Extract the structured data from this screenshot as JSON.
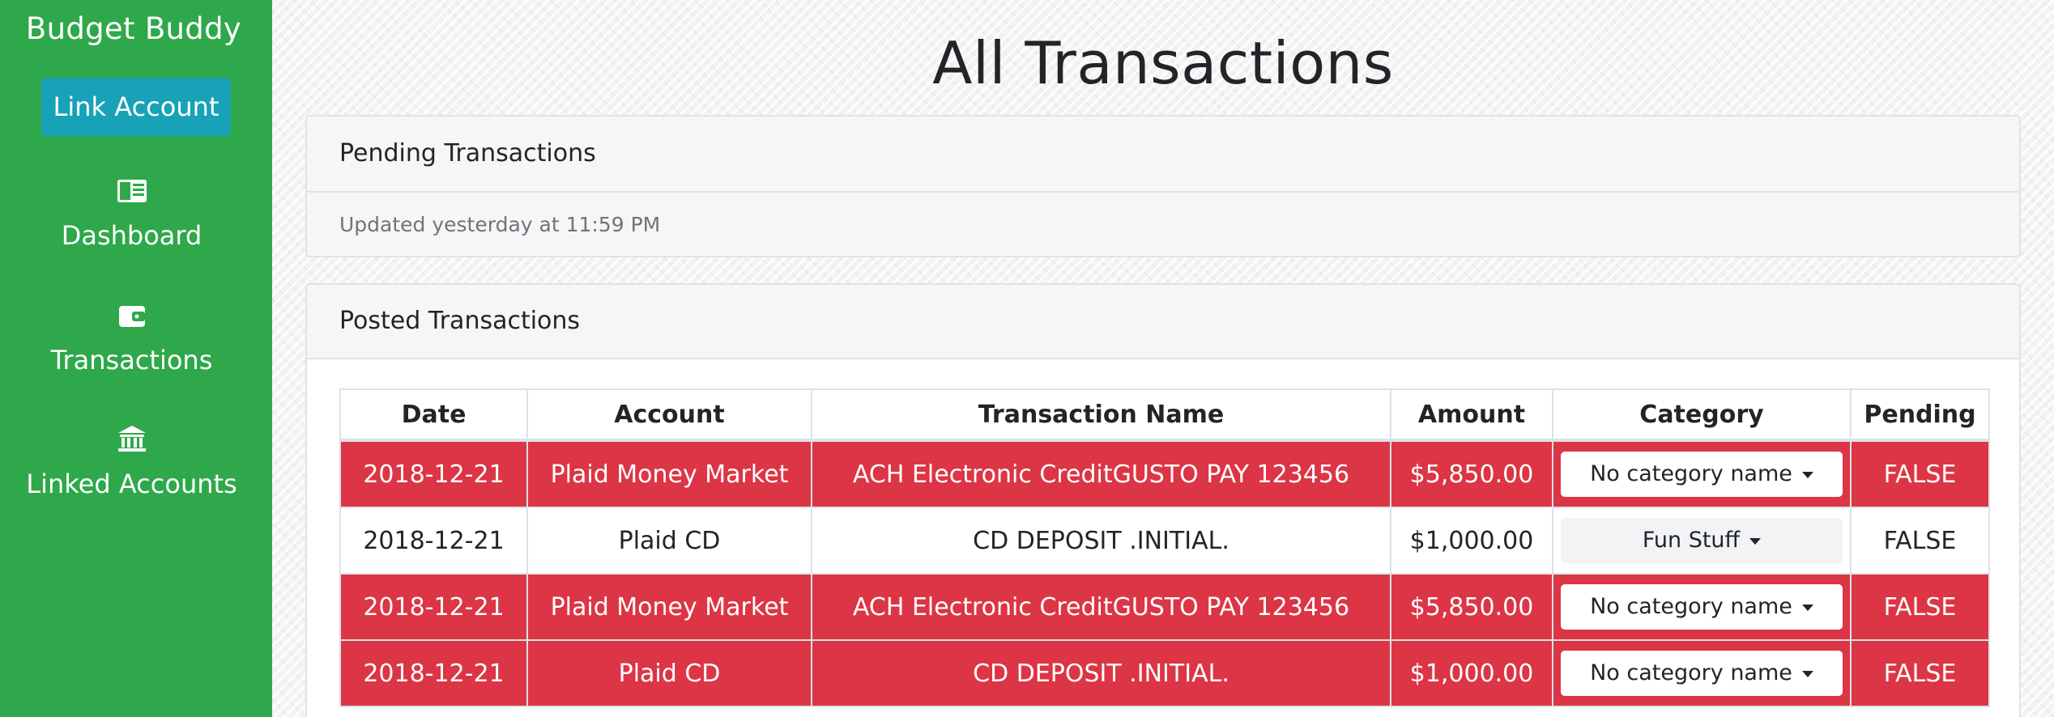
{
  "app": {
    "brand": "Budget Buddy",
    "link_account_label": "Link Account"
  },
  "sidebar": {
    "items": [
      {
        "label": "Dashboard",
        "icon": "dashboard-icon"
      },
      {
        "label": "Transactions",
        "icon": "wallet-icon"
      },
      {
        "label": "Linked Accounts",
        "icon": "bank-icon"
      }
    ]
  },
  "page": {
    "title": "All Transactions"
  },
  "pending": {
    "header": "Pending Transactions",
    "updated": "Updated yesterday at 11:59 PM"
  },
  "posted": {
    "header": "Posted Transactions",
    "columns": [
      "Date",
      "Account",
      "Transaction Name",
      "Amount",
      "Category",
      "Pending"
    ],
    "rows": [
      {
        "date": "2018-12-21",
        "account": "Plaid Money Market",
        "name": "ACH Electronic CreditGUSTO PAY 123456",
        "amount": "$5,850.00",
        "category": "No category name",
        "pending": "FALSE",
        "highlight": true
      },
      {
        "date": "2018-12-21",
        "account": "Plaid CD",
        "name": "CD DEPOSIT .INITIAL.",
        "amount": "$1,000.00",
        "category": "Fun Stuff",
        "pending": "FALSE",
        "highlight": false
      },
      {
        "date": "2018-12-21",
        "account": "Plaid Money Market",
        "name": "ACH Electronic CreditGUSTO PAY 123456",
        "amount": "$5,850.00",
        "category": "No category name",
        "pending": "FALSE",
        "highlight": true
      },
      {
        "date": "2018-12-21",
        "account": "Plaid CD",
        "name": "CD DEPOSIT .INITIAL.",
        "amount": "$1,000.00",
        "category": "No category name",
        "pending": "FALSE",
        "highlight": true
      }
    ]
  },
  "colors": {
    "sidebar_bg": "#2ea84a",
    "link_button_bg": "#17a2b8",
    "danger_row": "#dc3545"
  }
}
